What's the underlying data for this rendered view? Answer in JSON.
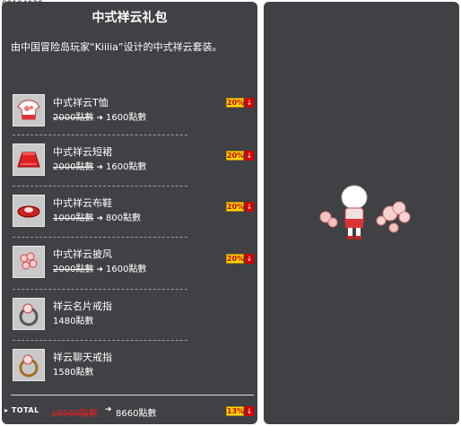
{
  "item_code": "09104039",
  "package": {
    "title": "中式祥云礼包",
    "description": "由中国冒险岛玩家“Kiilia”设计的中式祥云套装。"
  },
  "items": [
    {
      "name": "中式祥云T恤",
      "old_price": "2000點數",
      "new_price": "1600點數",
      "discount": "20%",
      "icon": "shirt-icon"
    },
    {
      "name": "中式祥云短裙",
      "old_price": "2000點數",
      "new_price": "1600點數",
      "discount": "20%",
      "icon": "skirt-icon"
    },
    {
      "name": "中式祥云布鞋",
      "old_price": "1000點數",
      "new_price": "800點數",
      "discount": "20%",
      "icon": "shoe-icon"
    },
    {
      "name": "中式祥云披风",
      "old_price": "2000點數",
      "new_price": "1600點數",
      "discount": "20%",
      "icon": "cape-icon"
    },
    {
      "name": "祥云名片戒指",
      "price": "1480點數",
      "icon": "ring-icon"
    },
    {
      "name": "祥云聊天戒指",
      "price": "1580點數",
      "icon": "ring-icon"
    }
  ],
  "total": {
    "label": "TOTAL",
    "old_price": "10960點數",
    "new_price": "8660點數",
    "discount": "13%"
  },
  "colors": {
    "panel": "#3f4145",
    "badge": "#ffd700",
    "down": "#d20000"
  }
}
